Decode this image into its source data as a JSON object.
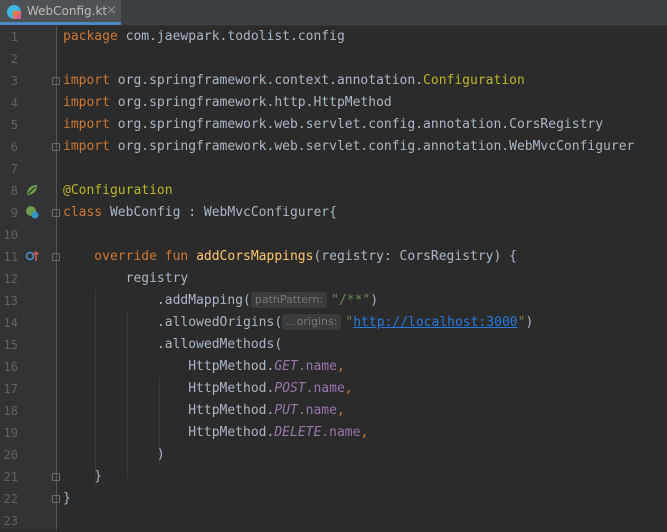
{
  "tab": {
    "label": "WebConfig.kt",
    "close": "×",
    "icon": "kotlin-file-icon"
  },
  "colors": {
    "background": "#2b2b2b",
    "keyword": "#cc7832",
    "string": "#6a8759",
    "annotation": "#bbb529",
    "function": "#ffc66d",
    "enum": "#9876aa",
    "url": "#287bde"
  },
  "line_numbers": [
    "1",
    "2",
    "3",
    "4",
    "5",
    "6",
    "7",
    "8",
    "9",
    "10",
    "11",
    "12",
    "13",
    "14",
    "15",
    "16",
    "17",
    "18",
    "19",
    "20",
    "21",
    "22",
    "23"
  ],
  "code": {
    "l1_kw": "package",
    "l1_rest": " com.jaewpark.todolist.config",
    "l3_kw": "import",
    "l3_rest": " org.springframework.context.annotation.",
    "l3_cls": "Configuration",
    "l4_kw": "import",
    "l4_rest": " org.springframework.http.HttpMethod",
    "l5_kw": "import",
    "l5_rest": " org.springframework.web.servlet.config.annotation.CorsRegistry",
    "l6_kw": "import",
    "l6_rest": " org.springframework.web.servlet.config.annotation.WebMvcConfigurer",
    "l8_anno": "@Configuration",
    "l9_kw": "class",
    "l9_rest": " WebConfig : WebMvcConfigurer{",
    "l11_kw": "    override fun ",
    "l11_fn": "addCorsMappings",
    "l11_rest": "(registry: CorsRegistry) {",
    "l12": "        registry",
    "l13_a": "            .addMapping(",
    "l13_hint": "pathPattern:",
    "l13_str": "\"/**\"",
    "l13_b": ")",
    "l14_a": "            .allowedOrigins(",
    "l14_hint": "...origins:",
    "l14_q1": "\"",
    "l14_url": "http://localhost:3000",
    "l14_q2": "\"",
    "l14_b": ")",
    "l15": "            .allowedMethods(",
    "l16_a": "                HttpMethod.",
    "l16_e": "GET",
    "l16_p": ".name",
    "l16_c": ",",
    "l17_a": "                HttpMethod.",
    "l17_e": "POST",
    "l17_p": ".name",
    "l17_c": ",",
    "l18_a": "                HttpMethod.",
    "l18_e": "PUT",
    "l18_p": ".name",
    "l18_c": ",",
    "l19_a": "                HttpMethod.",
    "l19_e": "DELETE",
    "l19_p": ".name",
    "l19_c": ",",
    "l20": "            )",
    "l21": "    }",
    "l22": "}"
  },
  "gutter_icons": {
    "l8": "spring-bean-icon",
    "l9": "spring-config-icon",
    "l11": "override-method-icon"
  }
}
